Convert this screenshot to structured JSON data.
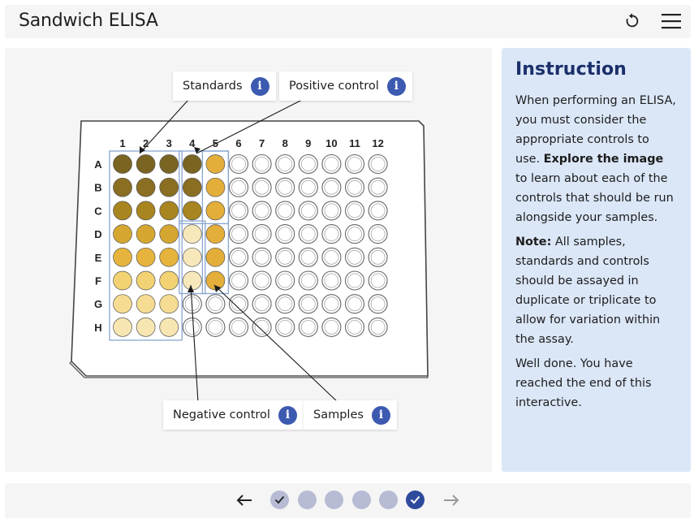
{
  "app": {
    "title": "Sandwich ELISA"
  },
  "toolbar": {
    "reset_icon": "reset-icon",
    "menu_icon": "menu-icon"
  },
  "plate": {
    "columns": [
      "1",
      "2",
      "3",
      "4",
      "5",
      "6",
      "7",
      "8",
      "9",
      "10",
      "11",
      "12"
    ],
    "rows": [
      "A",
      "B",
      "C",
      "D",
      "E",
      "F",
      "G",
      "H"
    ],
    "colors": {
      "dark1": "#7a6422",
      "dark2": "#8a6e22",
      "dark3": "#a8851f",
      "mid1": "#d6a730",
      "mid2": "#e6b43c",
      "light1": "#f2d272",
      "light2": "#f5dc92",
      "pale": "#f8e6b2",
      "neg": "#f7e8bc",
      "pos": "#e3ae3a",
      "empty": "#ffffff",
      "outline": "#88a6cf"
    }
  },
  "labels": {
    "standards": "Standards",
    "positive_control": "Positive control",
    "negative_control": "Negative control",
    "samples": "Samples"
  },
  "instruction": {
    "title": "Instruction",
    "p1_a": "When performing an ELISA, you must consider the appropriate controls to use. ",
    "p1_bold": "Explore the image",
    "p1_b": " to learn about each of the controls that should be run alongside your samples.",
    "p2_bold": "Note:",
    "p2_rest": " All samples, standards and controls should be assayed in duplicate or triplicate to allow for variation within the assay.",
    "p3": "Well done. You have reached the end of this interactive."
  },
  "navigation": {
    "prev_icon": "arrow-left-icon",
    "next_icon": "arrow-right-icon",
    "steps": [
      {
        "state": "visited"
      },
      {
        "state": "unvisited"
      },
      {
        "state": "unvisited"
      },
      {
        "state": "unvisited"
      },
      {
        "state": "unvisited"
      },
      {
        "state": "current-complete"
      }
    ],
    "colors": {
      "dot": "#b7bbd3",
      "current": "#2e4a9c"
    }
  }
}
